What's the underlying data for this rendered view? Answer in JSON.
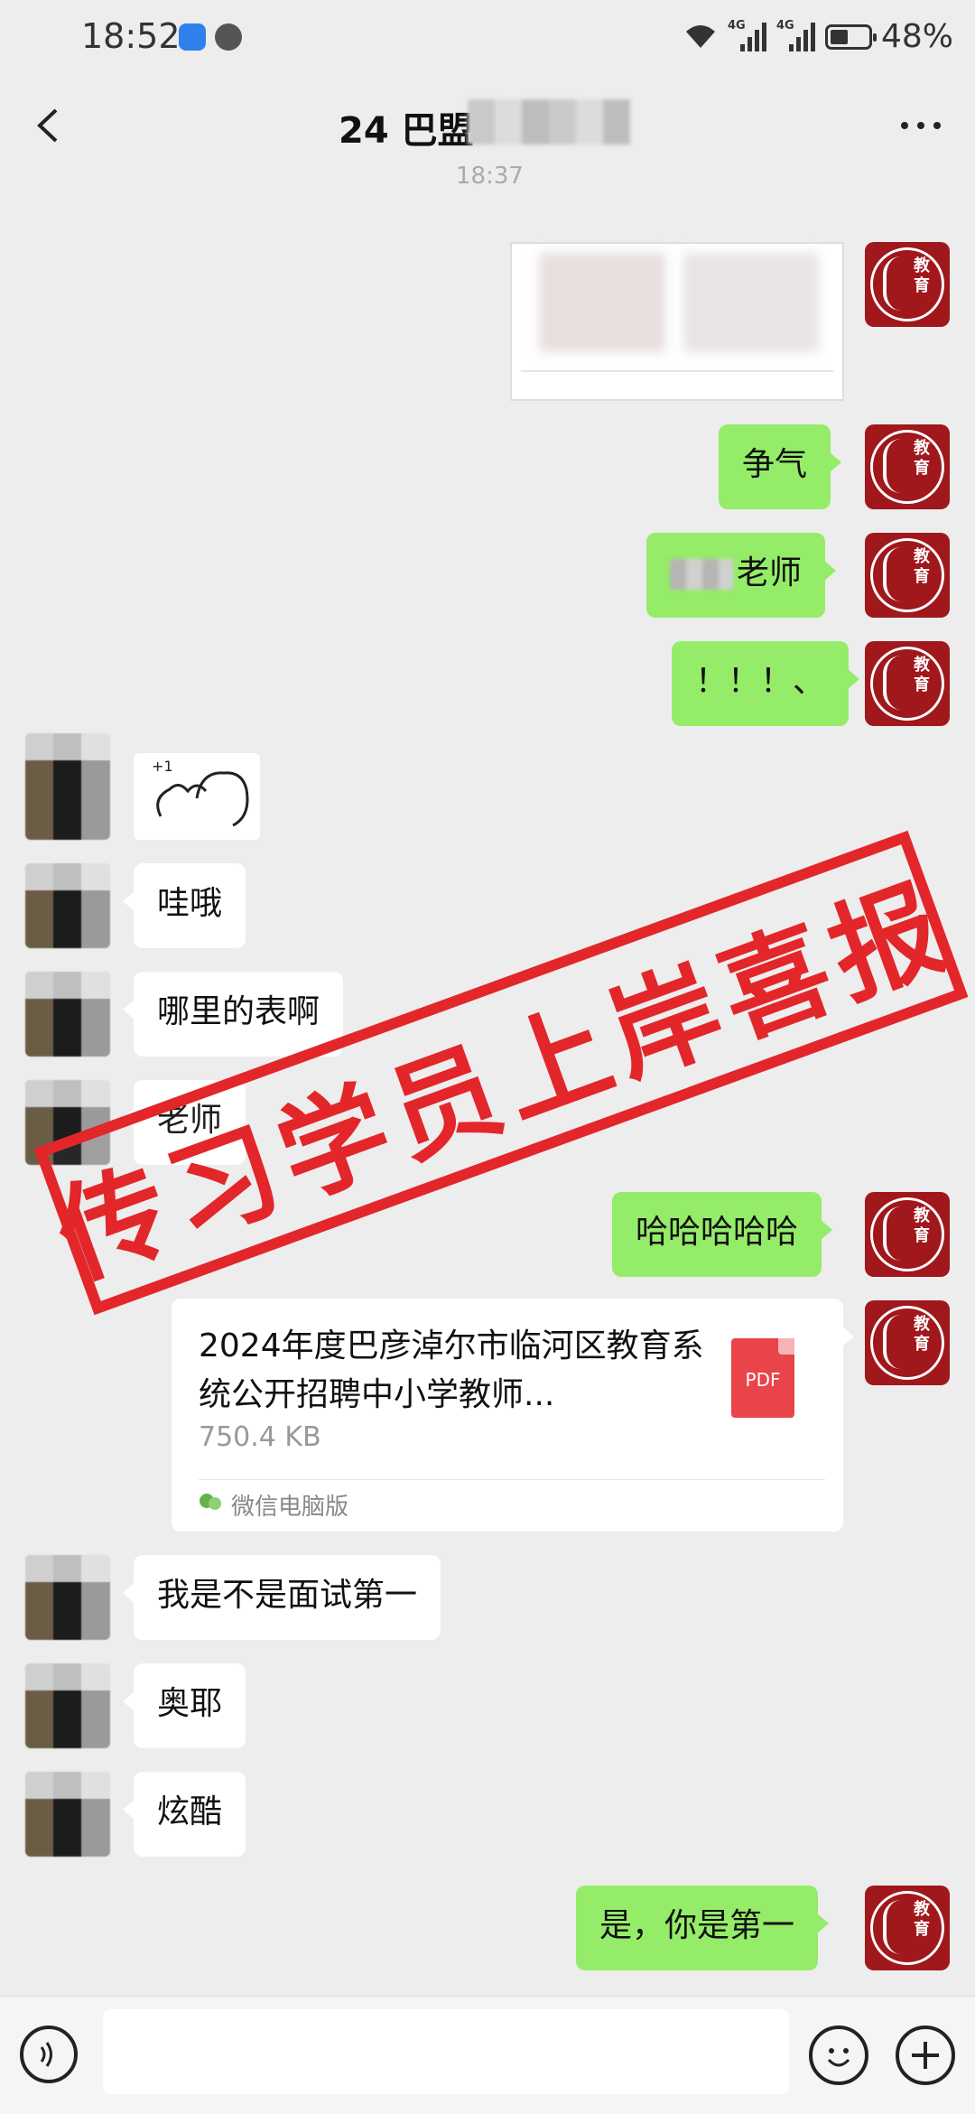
{
  "status_bar": {
    "time": "18:52",
    "network_1": "4G",
    "network_2": "4G",
    "battery_percent_text": "48%",
    "battery_level": 0.48
  },
  "header": {
    "title": "24 巴盟",
    "timestamp": "18:37"
  },
  "messages": {
    "m1": "争气",
    "m2_suffix": "老师",
    "m3": "！！！、",
    "o1": "哇哦",
    "o2": "哪里的表啊",
    "o3": "老师",
    "m4": "哈哈哈哈哈",
    "o4": "我是不是面试第一",
    "o5": "奥耶",
    "o6": "炫酷",
    "m5": "是，你是第一"
  },
  "file_card": {
    "name": "2024年度巴彦淖尔市临河区教育系统公开招聘中小学教师...",
    "size": "750.4 KB",
    "icon_label": "PDF",
    "source": "微信电脑版"
  },
  "avatar_me": {
    "text": "教育"
  },
  "stamp": {
    "text": "传习学员上岸喜报",
    "color": "#e3262a"
  },
  "colors": {
    "me_bubble": "#95ec69",
    "other_bubble": "#ffffff",
    "background": "#ededed",
    "avatar_me": "#a0171c"
  }
}
